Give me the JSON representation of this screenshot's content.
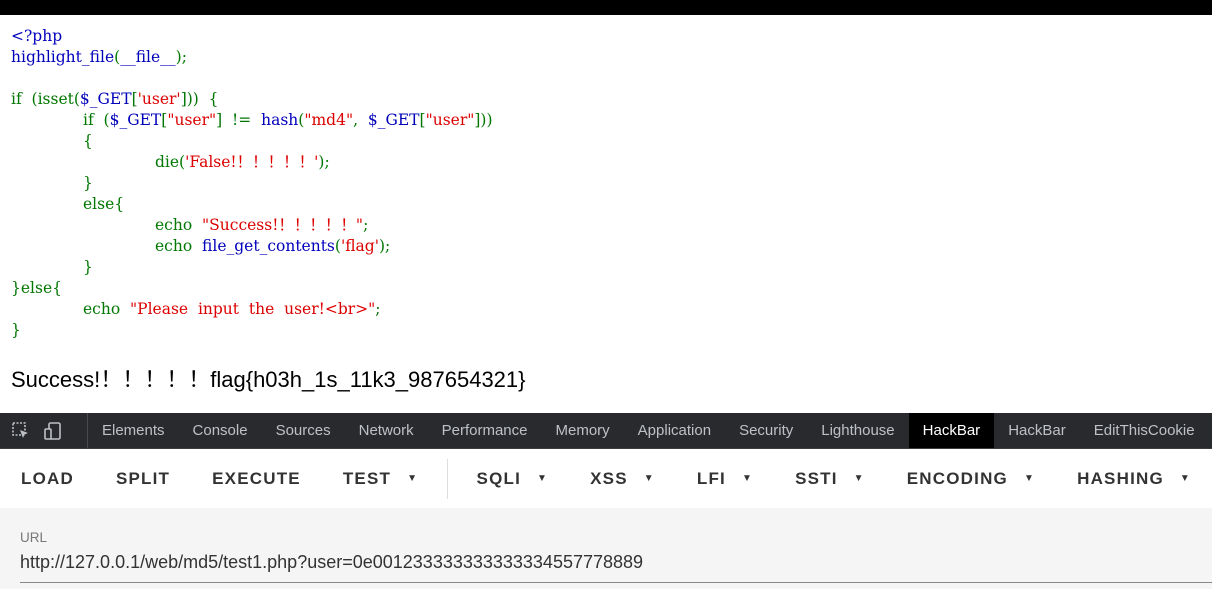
{
  "code_lines": [
    {
      "indent": 1,
      "parts": [
        {
          "t": "<?php",
          "c": "blue"
        }
      ]
    },
    {
      "indent": 1,
      "parts": [
        {
          "t": "highlight_file",
          "c": "blue"
        },
        {
          "t": "(",
          "c": "green"
        },
        {
          "t": "__file__",
          "c": "blue"
        },
        {
          "t": ");",
          "c": "green"
        }
      ]
    },
    {
      "indent": 1,
      "parts": []
    },
    {
      "indent": 1,
      "parts": [
        {
          "t": "if  (isset(",
          "c": "green"
        },
        {
          "t": "$_GET",
          "c": "blue"
        },
        {
          "t": "[",
          "c": "green"
        },
        {
          "t": "'user'",
          "c": "red"
        },
        {
          "t": "]))  {",
          "c": "green"
        }
      ]
    },
    {
      "indent": 2,
      "parts": [
        {
          "t": "if  (",
          "c": "green"
        },
        {
          "t": "$_GET",
          "c": "blue"
        },
        {
          "t": "[",
          "c": "green"
        },
        {
          "t": "\"user\"",
          "c": "red"
        },
        {
          "t": "]  !=  ",
          "c": "green"
        },
        {
          "t": "hash",
          "c": "blue"
        },
        {
          "t": "(",
          "c": "green"
        },
        {
          "t": "\"md4\"",
          "c": "red"
        },
        {
          "t": ",  ",
          "c": "green"
        },
        {
          "t": "$_GET",
          "c": "blue"
        },
        {
          "t": "[",
          "c": "green"
        },
        {
          "t": "\"user\"",
          "c": "red"
        },
        {
          "t": "]))",
          "c": "green"
        }
      ]
    },
    {
      "indent": 2,
      "parts": [
        {
          "t": "{",
          "c": "green"
        }
      ]
    },
    {
      "indent": 3,
      "parts": [
        {
          "t": "die(",
          "c": "green"
        },
        {
          "t": "'False!！！！！！'",
          "c": "red"
        },
        {
          "t": ");",
          "c": "green"
        }
      ]
    },
    {
      "indent": 2,
      "parts": [
        {
          "t": "}",
          "c": "green"
        }
      ]
    },
    {
      "indent": 2,
      "parts": [
        {
          "t": "else{",
          "c": "green"
        }
      ]
    },
    {
      "indent": 3,
      "parts": [
        {
          "t": "echo  ",
          "c": "green"
        },
        {
          "t": "\"Success!！！！！！\"",
          "c": "red"
        },
        {
          "t": ";",
          "c": "green"
        }
      ]
    },
    {
      "indent": 3,
      "parts": [
        {
          "t": "echo  ",
          "c": "green"
        },
        {
          "t": "file_get_contents",
          "c": "blue"
        },
        {
          "t": "(",
          "c": "green"
        },
        {
          "t": "'flag'",
          "c": "red"
        },
        {
          "t": ");",
          "c": "green"
        }
      ]
    },
    {
      "indent": 2,
      "parts": [
        {
          "t": "}",
          "c": "green"
        }
      ]
    },
    {
      "indent": 1,
      "parts": [
        {
          "t": "}else{",
          "c": "green"
        }
      ]
    },
    {
      "indent": 2,
      "parts": [
        {
          "t": "echo  ",
          "c": "green"
        },
        {
          "t": "\"Please  input  the  user!<br>\"",
          "c": "red"
        },
        {
          "t": ";",
          "c": "green"
        }
      ]
    },
    {
      "indent": 1,
      "parts": [
        {
          "t": "}",
          "c": "green"
        }
      ]
    }
  ],
  "result_text": "Success!！！！！！flag{h03h_1s_11k3_987654321}",
  "devtools": {
    "icons": [
      "inspect-icon",
      "device-toggle-icon"
    ],
    "tabs": [
      "Elements",
      "Console",
      "Sources",
      "Network",
      "Performance",
      "Memory",
      "Application",
      "Security",
      "Lighthouse",
      "HackBar",
      "HackBar",
      "EditThisCookie"
    ],
    "active_tab_index": 9
  },
  "hackbar": {
    "buttons": [
      {
        "label": "LOAD",
        "dropdown": false
      },
      {
        "label": "SPLIT",
        "dropdown": false
      },
      {
        "label": "EXECUTE",
        "dropdown": false
      },
      {
        "label": "TEST",
        "dropdown": true
      },
      {
        "label": "SQLI",
        "dropdown": true
      },
      {
        "label": "XSS",
        "dropdown": true
      },
      {
        "label": "LFI",
        "dropdown": true
      },
      {
        "label": "SSTI",
        "dropdown": true
      },
      {
        "label": "ENCODING",
        "dropdown": true
      },
      {
        "label": "HASHING",
        "dropdown": true
      }
    ]
  },
  "url": {
    "label": "URL",
    "value": "http://127.0.0.1/web/md5/test1.php?user=0e001233333333333334557778889"
  },
  "colors": {
    "code_blue": "#0000BB",
    "code_green": "#007700",
    "code_red": "#DD0000",
    "devtools_bg": "#292a2d",
    "active_tab_bg": "#000000"
  }
}
